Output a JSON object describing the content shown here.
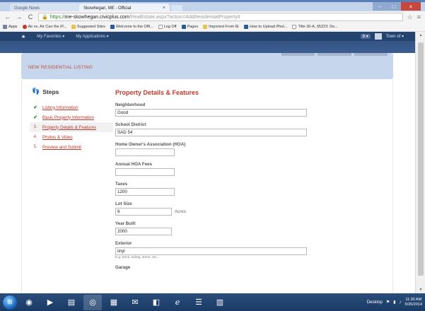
{
  "browser": {
    "tabs": [
      {
        "label": "Google News",
        "active": false
      },
      {
        "label": "Skowhegan, ME - Official",
        "active": true
      }
    ],
    "url": {
      "scheme": "https://",
      "host": "me-skowhegan.civicplus.com",
      "path": "/RealEstate.aspx?action=AddResidentialProperty#"
    },
    "bookmarks": [
      {
        "label": "Apps",
        "icon": "grid-icon"
      },
      {
        "label": "Air vs. Air Can the iP...",
        "icon": "red-circle-icon"
      },
      {
        "label": "Suggested Sites",
        "icon": "folder-icon"
      },
      {
        "label": "Welcome to the Offi...",
        "icon": "site-icon"
      },
      {
        "label": "Log Off",
        "icon": "page-icon"
      },
      {
        "label": "Pages",
        "icon": "site-icon"
      },
      {
        "label": "Imported From IE",
        "icon": "folder-icon"
      },
      {
        "label": "How to Upload Phot...",
        "icon": "doc-icon"
      },
      {
        "label": "Title 30-A, §5223: De...",
        "icon": "page-icon"
      }
    ]
  },
  "site_nav": {
    "items": [
      "My Favorites ▾",
      "My Applications ▾"
    ],
    "badge": "8 ▾",
    "town_label": "Town of ▾"
  },
  "banner": {
    "title": "NEW RESIDENTIAL LISTING"
  },
  "steps": {
    "title": "Steps",
    "items": [
      {
        "marker": "✔",
        "kind": "check",
        "label": "Listing Information"
      },
      {
        "marker": "✔",
        "kind": "check",
        "label": "Basic Property Information"
      },
      {
        "marker": "3.",
        "kind": "num",
        "label": "Property Details & Features"
      },
      {
        "marker": "4.",
        "kind": "num",
        "label": "Photos & Video"
      },
      {
        "marker": "5.",
        "kind": "num",
        "label": "Preview and Submit"
      }
    ]
  },
  "form": {
    "title": "Property Details & Features",
    "fields": {
      "neighborhood": {
        "label": "Neighborhood",
        "value": "Good"
      },
      "school_district": {
        "label": "School District",
        "value": "SAD 54"
      },
      "hoa": {
        "label": "Home Owner's Association (HOA)",
        "value": ""
      },
      "hoa_fees": {
        "label": "Annual HOA Fees",
        "value": ""
      },
      "taxes": {
        "label": "Taxes",
        "value": "1200"
      },
      "lot_size": {
        "label": "Lot Size",
        "value": "6",
        "unit": "Acres"
      },
      "year_built": {
        "label": "Year Built",
        "value": "2000"
      },
      "exterior": {
        "label": "Exterior",
        "value": "iinyl",
        "hint": "E.g. brick, siding, stone, etc..."
      },
      "garage": {
        "label": "Garage"
      }
    }
  },
  "taskbar": {
    "desktop_label": "Desktop",
    "time": "11:30 AM",
    "date": "5/26/2014"
  }
}
